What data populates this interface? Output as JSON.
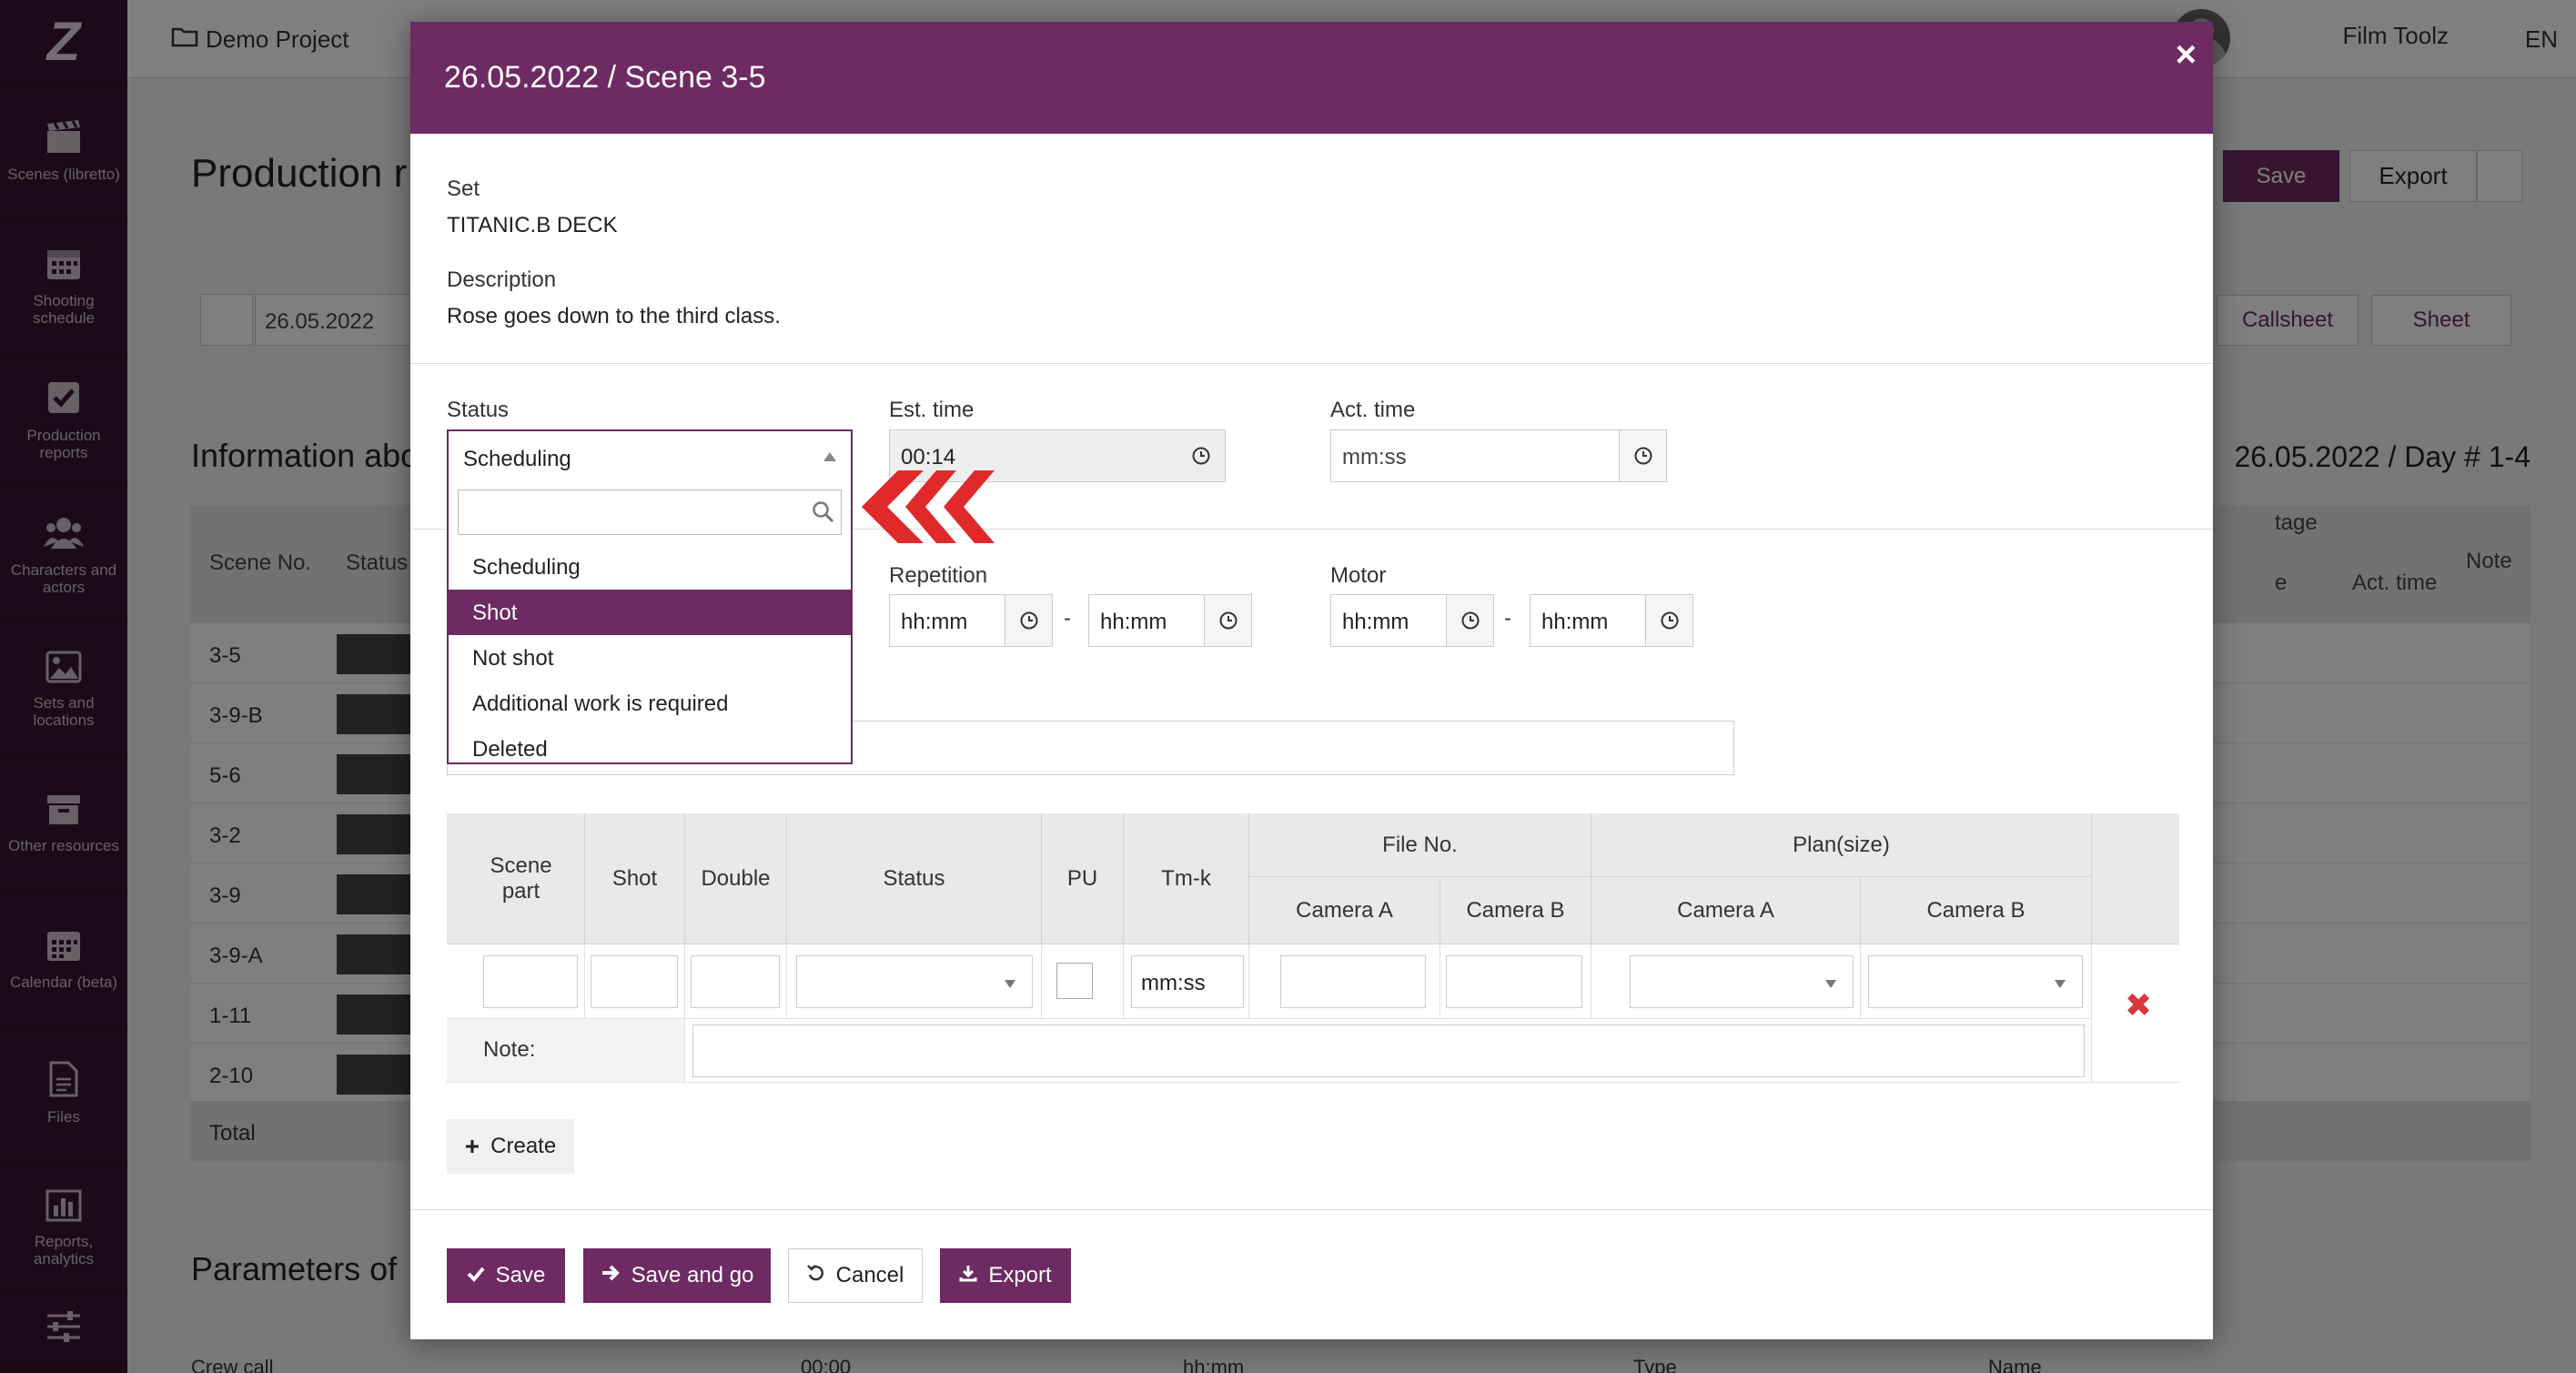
{
  "sidebar": {
    "logo": "Z",
    "items": [
      {
        "label": "Scenes (libretto)",
        "icon": "clapperboard-icon"
      },
      {
        "label": "Shooting schedule",
        "icon": "calendar-icon"
      },
      {
        "label": "Production reports",
        "icon": "checkbox-icon"
      },
      {
        "label": "Characters and actors",
        "icon": "users-icon"
      },
      {
        "label": "Sets and locations",
        "icon": "image-icon"
      },
      {
        "label": "Other resources",
        "icon": "archive-icon"
      },
      {
        "label": "Calendar (beta)",
        "icon": "calendar-grid-icon"
      },
      {
        "label": "Files",
        "icon": "file-icon"
      },
      {
        "label": "Reports, analytics",
        "icon": "bar-chart-icon"
      },
      {
        "label": "",
        "icon": "sliders-icon"
      }
    ]
  },
  "topbar": {
    "project": "Demo Project",
    "user": "Film Toolz",
    "lang": "EN"
  },
  "background": {
    "title": "Production r",
    "save": "Save",
    "export": "Export",
    "date": "26.05.2022",
    "callsheet": "Callsheet",
    "sheet": "Sheet",
    "info_heading": "Information abo",
    "day_heading": "26.05.2022 / Day # 1-4",
    "columns": {
      "scene_no": "Scene No.",
      "status": "Status",
      "footage": "tage",
      "footage_sub": "e",
      "act_time": "Act. time",
      "note": "Note"
    },
    "rows": [
      "3-5",
      "3-9-B",
      "5-6",
      "3-2",
      "3-9",
      "3-9-A",
      "1-11",
      "2-10"
    ],
    "total": "Total",
    "params_heading": "Parameters of",
    "last_row": {
      "col1": "Crew call",
      "col2": "00:00",
      "col3": "hh:mm",
      "col4": "Type",
      "col5": "Name"
    }
  },
  "modal": {
    "title": "26.05.2022 / Scene 3-5",
    "set_label": "Set",
    "set_value": "TITANIC.B DECK",
    "description_label": "Description",
    "description_value": "Rose goes down to the third class.",
    "status_label": "Status",
    "status_value": "Scheduling",
    "status_options": [
      "Scheduling",
      "Shot",
      "Not shot",
      "Additional work is required",
      "Deleted"
    ],
    "status_highlighted": "Shot",
    "est_time_label": "Est. time",
    "est_time_value": "00:14",
    "act_time_label": "Act. time",
    "act_time_placeholder": "mm:ss",
    "repetition_label": "Repetition",
    "repetition_from": "hh:mm",
    "repetition_to": "hh:mm",
    "motor_label": "Motor",
    "motor_from": "hh:mm",
    "motor_to": "hh:mm",
    "dash": "-",
    "table": {
      "headers": {
        "scene_part": "Scene part",
        "shot": "Shot",
        "double": "Double",
        "status": "Status",
        "pu": "PU",
        "tmk": "Tm-k",
        "file_no": "File No.",
        "plan_size": "Plan(size)",
        "camera_a": "Camera A",
        "camera_b": "Camera B"
      },
      "tmk_value": "mm:ss",
      "note_label": "Note:"
    },
    "create_button": "Create",
    "buttons": {
      "save": "Save",
      "save_and_go": "Save and go",
      "cancel": "Cancel",
      "export": "Export"
    }
  },
  "colors": {
    "brand": "#6e2a62",
    "sidebar": "#3a1530",
    "danger": "#d9363e",
    "arrow": "#e02a2a"
  }
}
